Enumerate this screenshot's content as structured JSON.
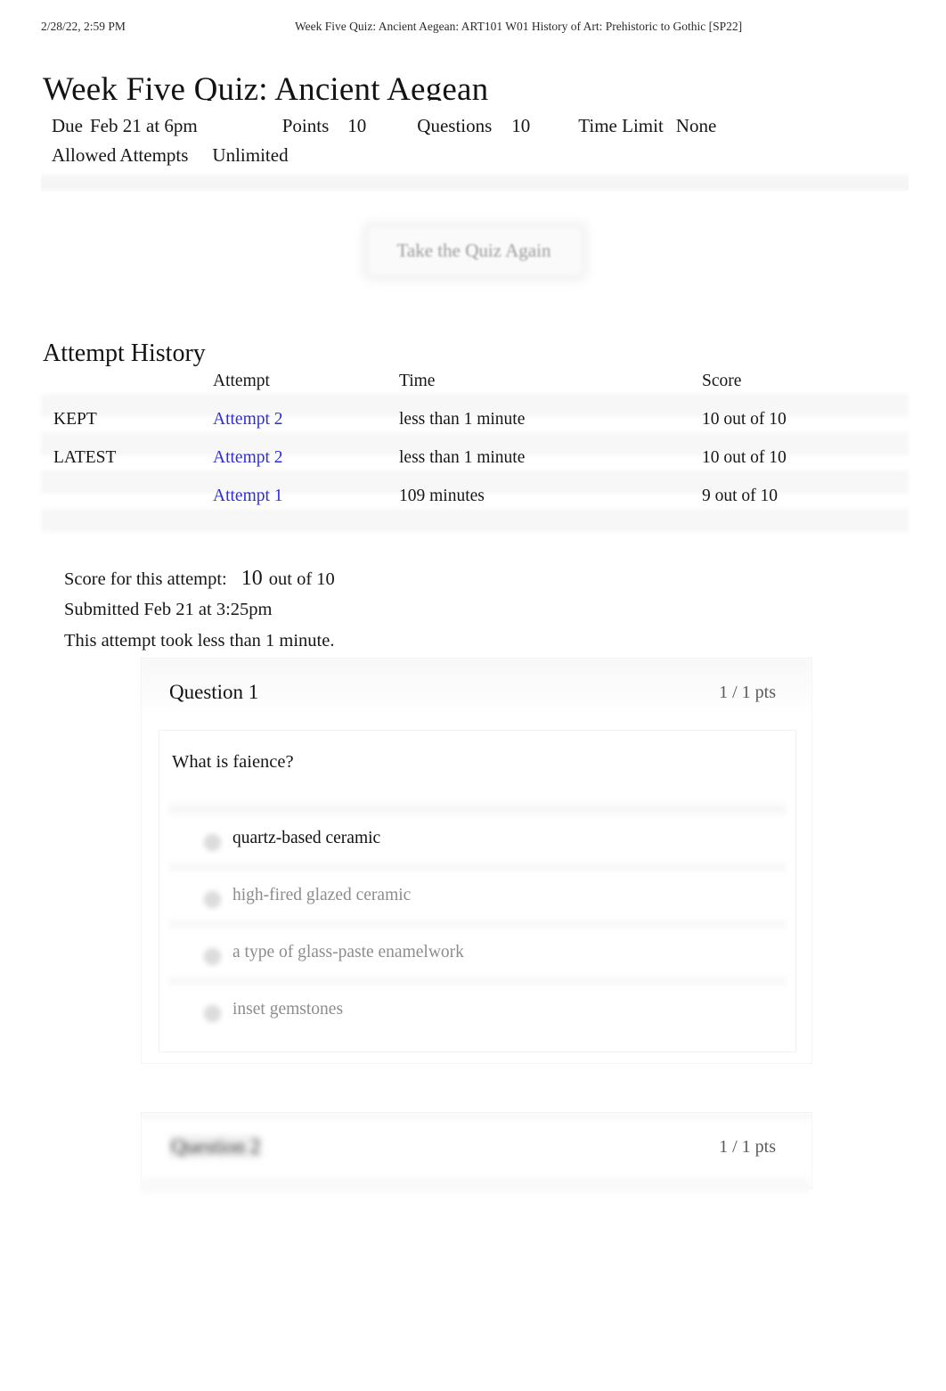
{
  "print_header": {
    "date": "2/28/22, 2:59 PM",
    "document_title": "Week Five Quiz: Ancient Aegean: ART101 W01 History of Art: Prehistoric to Gothic [SP22]"
  },
  "page": {
    "title": "Week Five Quiz: Ancient Aegean"
  },
  "meta": {
    "due_label": "Due",
    "due_value": "Feb 21 at 6pm",
    "points_label": "Points",
    "points_value": "10",
    "questions_label": "Questions",
    "questions_value": "10",
    "time_limit_label": "Time Limit",
    "time_limit_value": "None",
    "allowed_attempts_label": "Allowed Attempts",
    "allowed_attempts_value": "Unlimited"
  },
  "actions": {
    "retake_label": "Take the Quiz Again"
  },
  "attempt_history": {
    "heading": "Attempt History",
    "columns": [
      "",
      "Attempt",
      "Time",
      "Score"
    ],
    "rows": [
      {
        "flag": "KEPT",
        "attempt": "Attempt 2",
        "time": "less than 1 minute",
        "score": "10 out of 10"
      },
      {
        "flag": "LATEST",
        "attempt": "Attempt 2",
        "time": "less than 1 minute",
        "score": "10 out of 10"
      },
      {
        "flag": "",
        "attempt": "Attempt 1",
        "time": "109 minutes",
        "score": "9 out of 10"
      }
    ]
  },
  "attempt_summary": {
    "score_label": "Score for this attempt:",
    "score_value": "10",
    "score_suffix": "out of 10",
    "submitted": "Submitted Feb 21 at 3:25pm",
    "duration": "This attempt took less than 1 minute."
  },
  "questions": [
    {
      "name": "Question 1",
      "points": "1 / 1 pts",
      "prompt": "What is faience?",
      "answers": [
        {
          "text": "quartz-based ceramic",
          "selected": true
        },
        {
          "text": "high-fired glazed ceramic",
          "selected": false
        },
        {
          "text": "a type of glass-paste enamelwork",
          "selected": false
        },
        {
          "text": "inset gemstones",
          "selected": false
        }
      ]
    },
    {
      "name": "Question 2",
      "points": "1 / 1 pts",
      "prompt": "",
      "answers": []
    }
  ],
  "colors": {
    "link": "#2d2de0",
    "text": "#161616",
    "muted": "#8d8d8d",
    "card_border": "#f0f0f1",
    "band": "#f6f6f7"
  }
}
